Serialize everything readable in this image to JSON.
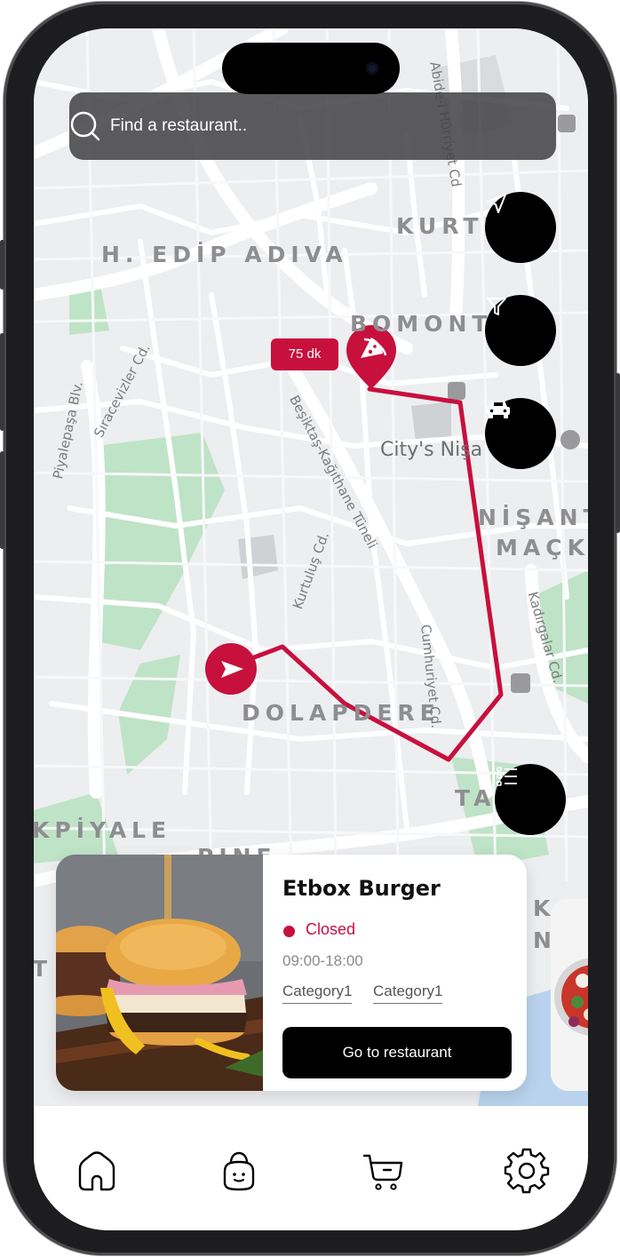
{
  "search": {
    "placeholder": "Find a restaurant.."
  },
  "map": {
    "districts": [
      "H. EDİP ADIVA",
      "KURTU",
      "BOMONT",
      "NİŞANT",
      "MAÇKA",
      "DOLAPDERE",
      "KPİYALE",
      "TA",
      "PINE",
      "K",
      "NF",
      "T"
    ],
    "streets": [
      "Piyalepaşa Blv.",
      "Sıracevizler Cd.",
      "Beşiktaş-Kağıthane Tüneli",
      "Kurtuluş Cd.",
      "Cumhuriyet Cd.",
      "Abide-i Hürriyet Cd",
      "Kadırgalar Cd."
    ],
    "poi": "City's Nişa",
    "duration_badge": "75 dk"
  },
  "fabs": {
    "locate_icon": "navigation-arrow-icon",
    "filter_icon": "filter-funnel-icon",
    "car_icon": "car-icon",
    "list_icon": "list-icon"
  },
  "restaurant_card": {
    "name": "Etbox Burger",
    "status": "Closed",
    "status_color": "#c8103d",
    "hours": "09:00-18:00",
    "categories": [
      "Category1",
      "Category1"
    ],
    "cta": "Go to restaurant"
  },
  "tabbar": {
    "items": [
      "home-icon",
      "bag-icon",
      "cart-icon",
      "settings-icon"
    ]
  },
  "colors": {
    "accent": "#c8103d",
    "dark": "#000000"
  }
}
